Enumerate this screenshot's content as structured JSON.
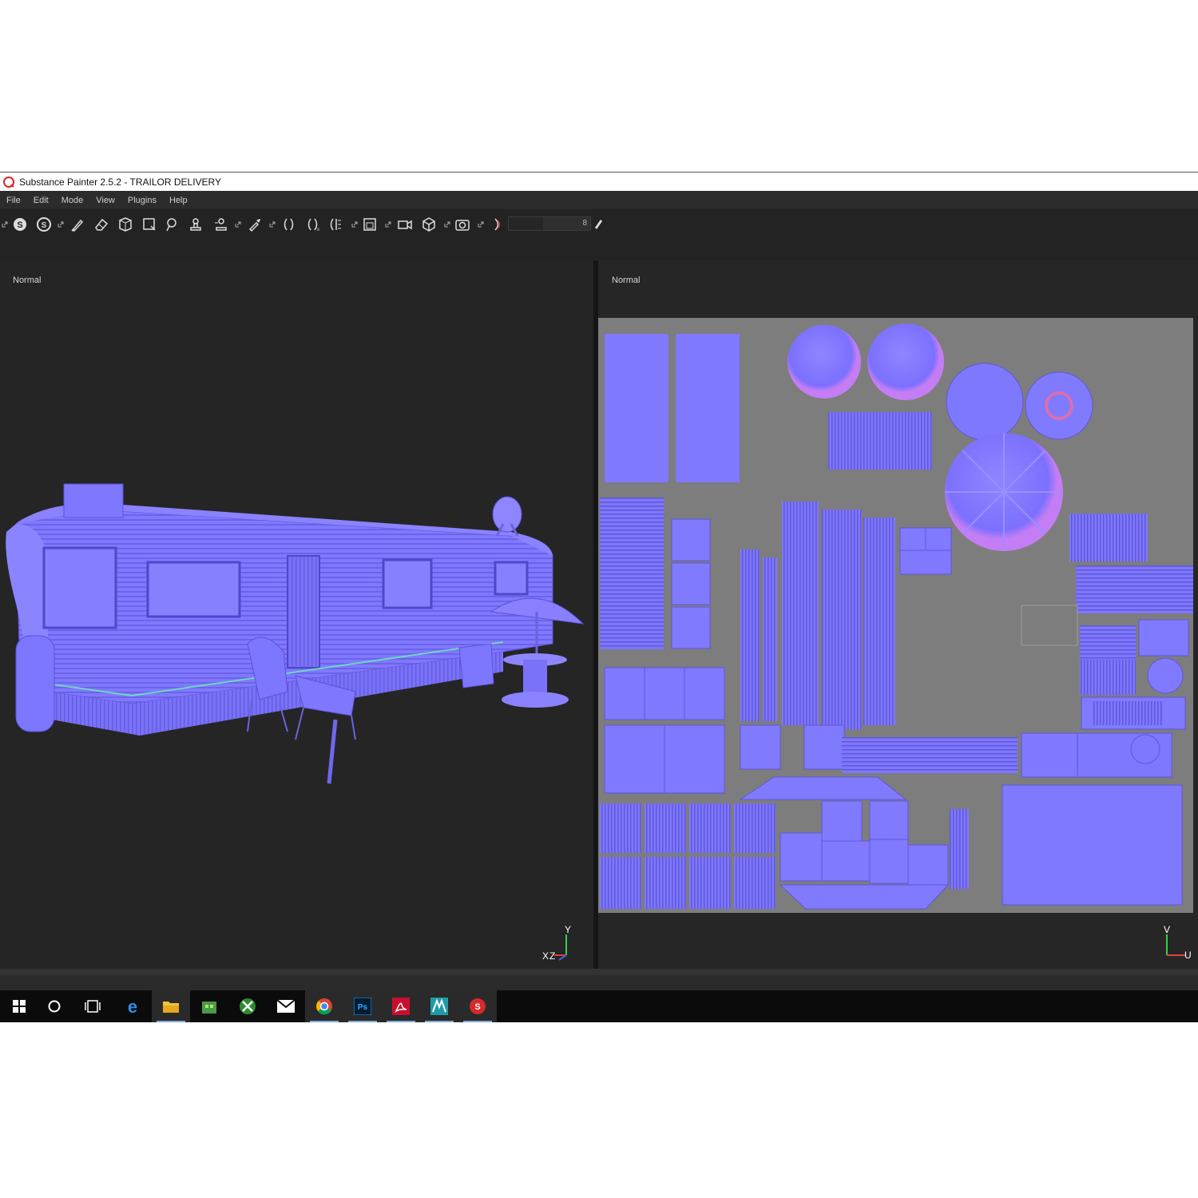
{
  "window": {
    "title": "Substance Painter 2.5.2 - TRAILOR DELIVERY",
    "app_icon": "substance-painter-icon"
  },
  "menu": {
    "items": [
      "File",
      "Edit",
      "Mode",
      "View",
      "Plugins",
      "Help"
    ]
  },
  "toolbar": {
    "tools": [
      "smart-material-icon",
      "substance-icon",
      "paint-brush-icon",
      "eraser-icon",
      "projection-icon",
      "polygon-fill-icon",
      "smudge-icon",
      "clone-icon",
      "clone-stamp-icon",
      "color-picker-icon",
      "symmetry-icon",
      "symmetry-x-icon",
      "symmetry-y-icon",
      "viewport-mode-icon",
      "camera-icon",
      "cube-icon",
      "screenshot-icon",
      "half-moon-icon"
    ],
    "brush_size_value": "8",
    "photoshop_label": "Ps"
  },
  "viewport_3d": {
    "channel": "Normal",
    "axis_x": "X",
    "axis_y": "Y",
    "axis_z": "Z"
  },
  "viewport_2d": {
    "channel": "Normal",
    "axis_v": "V",
    "axis_u": "U"
  },
  "taskbar": {
    "items": [
      "windows-start-icon",
      "cortana-search-icon",
      "task-view-icon",
      "edge-browser-icon",
      "file-explorer-icon",
      "store-icon",
      "xbox-icon",
      "mail-icon",
      "chrome-icon",
      "photoshop-icon",
      "acrobat-icon",
      "maya-icon",
      "substance-painter-taskbar-icon"
    ]
  },
  "colors": {
    "normal_map_base": "#7f7fff",
    "normal_map_light": "#8a84ff",
    "normal_map_dark": "#6c63e6",
    "uv_background": "#7d7d7d",
    "viewport_bg": "#252525"
  }
}
